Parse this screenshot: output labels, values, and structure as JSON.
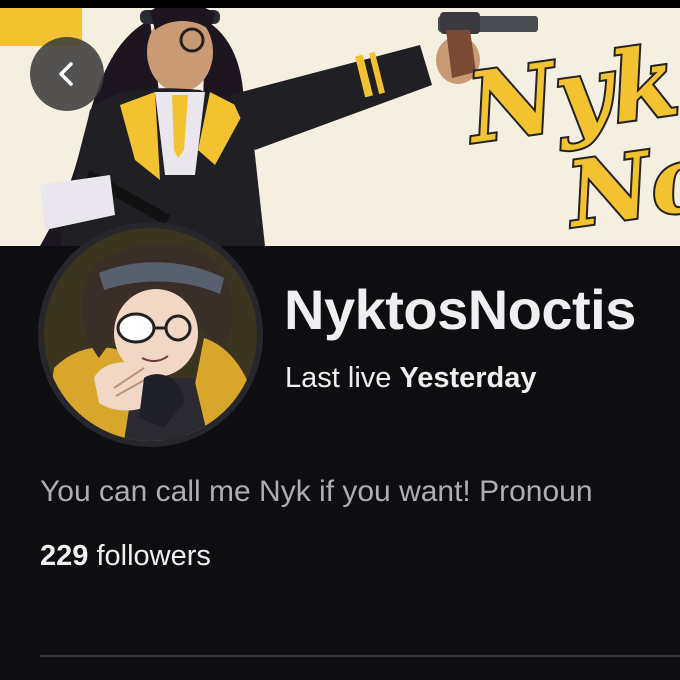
{
  "banner": {
    "artwork_text_line1": "Nyk",
    "artwork_text_line2": "No"
  },
  "colors": {
    "background": "#0e0e10",
    "banner_accent": "#f2c230",
    "text_primary": "#efeff1",
    "text_secondary": "#adadb8"
  },
  "navigation": {
    "back_icon": "chevron-left-icon"
  },
  "profile": {
    "channel_name": "NyktosNoctis",
    "last_live_label": "Last live",
    "last_live_value": "Yesterday",
    "bio": "You can call me Nyk if you want! Pronoun",
    "followers_count": "229",
    "followers_label": "followers"
  }
}
